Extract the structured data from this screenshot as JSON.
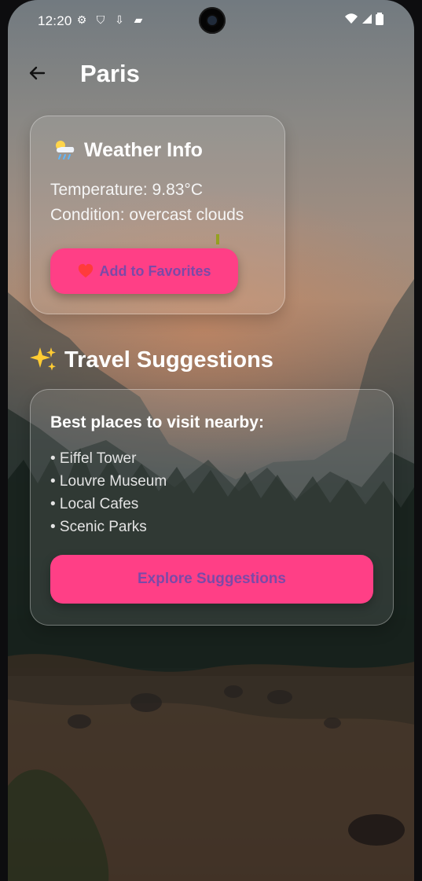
{
  "status_bar": {
    "time": "12:20"
  },
  "header": {
    "title": "Paris"
  },
  "weather": {
    "title": "Weather Info",
    "temperature": "Temperature: 9.83°C",
    "condition": "Condition: overcast clouds",
    "favorite_label": "Add to Favorites"
  },
  "travel": {
    "title": "Travel Suggestions",
    "subtitle": "Best places to visit nearby:",
    "places": [
      "• Eiffel Tower",
      "• Louvre Museum",
      "• Local Cafes",
      "• Scenic Parks"
    ],
    "button_label": "Explore Suggestions"
  },
  "icons": {
    "back": "arrow-left-icon",
    "weather": "cloud-sun-rain-icon",
    "favorite": "heart-icon",
    "travel": "sparkles-icon",
    "wifi": "wifi-icon",
    "signal": "signal-icon",
    "battery": "battery-icon"
  },
  "colors": {
    "accent": "#ff3f86",
    "button_text": "#7c49a7"
  }
}
